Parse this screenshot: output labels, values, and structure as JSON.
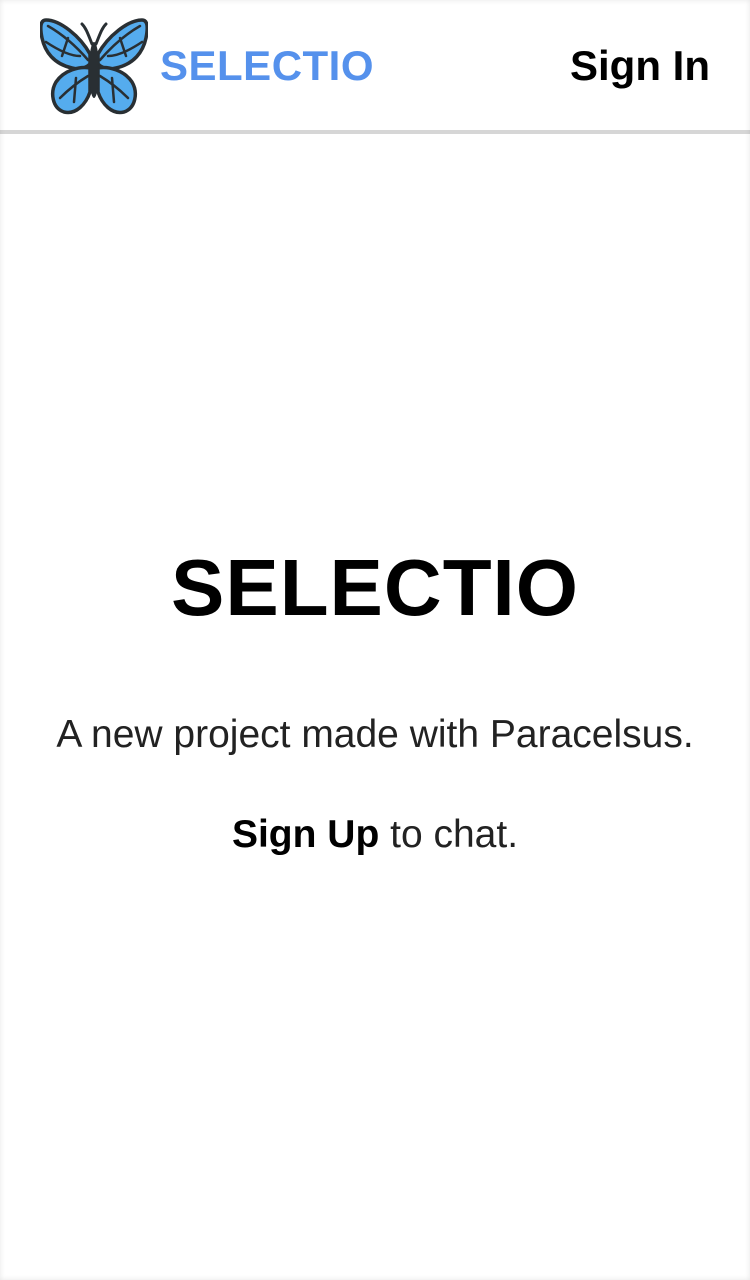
{
  "header": {
    "brand_name": "SELECTIO",
    "logo_icon": "butterfly-icon",
    "sign_in_label": "Sign In"
  },
  "hero": {
    "title": "SELECTIO",
    "subtitle": "A new project made with Paracelsus.",
    "signup_link": "Sign Up",
    "signup_suffix": " to chat."
  },
  "colors": {
    "brand": "#5591ec",
    "butterfly_wing": "#55acee",
    "butterfly_outline": "#292f33",
    "header_border": "#d6d6d6"
  }
}
